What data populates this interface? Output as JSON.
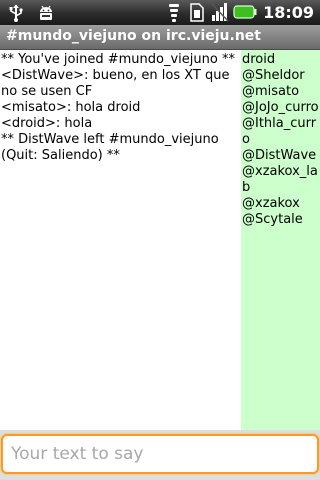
{
  "status_bar": {
    "time": "18:09",
    "icons": [
      "usb-icon",
      "android-debug-icon",
      "wifi-icon",
      "sim-icon",
      "signal-icon",
      "battery-icon"
    ]
  },
  "title_bar": {
    "title": "#mundo_viejuno on irc.vieju.net"
  },
  "chat": {
    "messages": [
      "** You've joined #mundo_viejuno **",
      "<DistWave>: bueno, en los XT que no se usen CF",
      "<misato>: hola droid",
      "<droid>: hola",
      "** DistWave left #mundo_viejuno (Quit: Saliendo) **"
    ]
  },
  "users": [
    "droid",
    "@Sheldor",
    "@misato",
    "@JoJo_curro",
    "@Ithla_curro",
    "@DistWave",
    "@xzakox_lab",
    "@xzakox",
    "@Scytale"
  ],
  "input": {
    "value": "",
    "placeholder": "Your text to say"
  },
  "colors": {
    "user_list_bg": "#ccffcc",
    "input_focus_border": "#ff9a1e",
    "title_bar_bg": "#7f7f7f"
  }
}
